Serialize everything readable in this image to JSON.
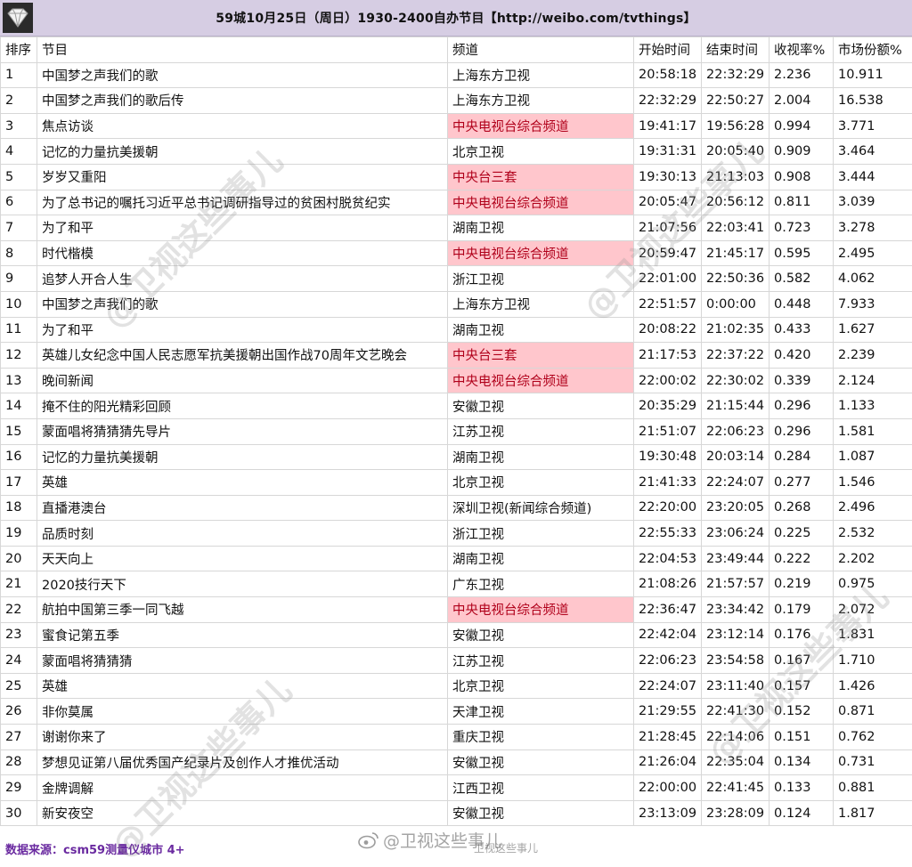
{
  "header": {
    "title": "59城10月25日（周日）1930-2400自办节目【http://weibo.com/tvthings】"
  },
  "columns": [
    "排序",
    "节目",
    "频道",
    "开始时间",
    "结束时间",
    "收视率%",
    "市场份额%"
  ],
  "rows": [
    {
      "rank": "1",
      "program": "中国梦之声我们的歌",
      "channel": "上海东方卫视",
      "start": "20:58:18",
      "end": "22:32:29",
      "rating": "2.236",
      "share": "10.911",
      "hl": false
    },
    {
      "rank": "2",
      "program": "中国梦之声我们的歌后传",
      "channel": "上海东方卫视",
      "start": "22:32:29",
      "end": "22:50:27",
      "rating": "2.004",
      "share": "16.538",
      "hl": false
    },
    {
      "rank": "3",
      "program": "焦点访谈",
      "channel": "中央电视台综合频道",
      "start": "19:41:17",
      "end": "19:56:28",
      "rating": "0.994",
      "share": "3.771",
      "hl": true
    },
    {
      "rank": "4",
      "program": "记忆的力量抗美援朝",
      "channel": "北京卫视",
      "start": "19:31:31",
      "end": "20:05:40",
      "rating": "0.909",
      "share": "3.464",
      "hl": false
    },
    {
      "rank": "5",
      "program": "岁岁又重阳",
      "channel": "中央台三套",
      "start": "19:30:13",
      "end": "21:13:03",
      "rating": "0.908",
      "share": "3.444",
      "hl": true
    },
    {
      "rank": "6",
      "program": "为了总书记的嘱托习近平总书记调研指导过的贫困村脱贫纪实",
      "channel": "中央电视台综合频道",
      "start": "20:05:47",
      "end": "20:56:12",
      "rating": "0.811",
      "share": "3.039",
      "hl": true
    },
    {
      "rank": "7",
      "program": "为了和平",
      "channel": "湖南卫视",
      "start": "21:07:56",
      "end": "22:03:41",
      "rating": "0.723",
      "share": "3.278",
      "hl": false
    },
    {
      "rank": "8",
      "program": "时代楷模",
      "channel": "中央电视台综合频道",
      "start": "20:59:47",
      "end": "21:45:17",
      "rating": "0.595",
      "share": "2.495",
      "hl": true
    },
    {
      "rank": "9",
      "program": "追梦人开合人生",
      "channel": "浙江卫视",
      "start": "22:01:00",
      "end": "22:50:36",
      "rating": "0.582",
      "share": "4.062",
      "hl": false
    },
    {
      "rank": "10",
      "program": "中国梦之声我们的歌",
      "channel": "上海东方卫视",
      "start": "22:51:57",
      "end": "0:00:00",
      "rating": "0.448",
      "share": "7.933",
      "hl": false
    },
    {
      "rank": "11",
      "program": "为了和平",
      "channel": "湖南卫视",
      "start": "20:08:22",
      "end": "21:02:35",
      "rating": "0.433",
      "share": "1.627",
      "hl": false
    },
    {
      "rank": "12",
      "program": "英雄儿女纪念中国人民志愿军抗美援朝出国作战70周年文艺晚会",
      "channel": "中央台三套",
      "start": "21:17:53",
      "end": "22:37:22",
      "rating": "0.420",
      "share": "2.239",
      "hl": true
    },
    {
      "rank": "13",
      "program": "晚间新闻",
      "channel": "中央电视台综合频道",
      "start": "22:00:02",
      "end": "22:30:02",
      "rating": "0.339",
      "share": "2.124",
      "hl": true
    },
    {
      "rank": "14",
      "program": "掩不住的阳光精彩回顾",
      "channel": "安徽卫视",
      "start": "20:35:29",
      "end": "21:15:44",
      "rating": "0.296",
      "share": "1.133",
      "hl": false
    },
    {
      "rank": "15",
      "program": "蒙面唱将猜猜猜先导片",
      "channel": "江苏卫视",
      "start": "21:51:07",
      "end": "22:06:23",
      "rating": "0.296",
      "share": "1.581",
      "hl": false
    },
    {
      "rank": "16",
      "program": "记忆的力量抗美援朝",
      "channel": "湖南卫视",
      "start": "19:30:48",
      "end": "20:03:14",
      "rating": "0.284",
      "share": "1.087",
      "hl": false
    },
    {
      "rank": "17",
      "program": "英雄",
      "channel": "北京卫视",
      "start": "21:41:33",
      "end": "22:24:07",
      "rating": "0.277",
      "share": "1.546",
      "hl": false
    },
    {
      "rank": "18",
      "program": "直播港澳台",
      "channel": "深圳卫视(新闻综合频道)",
      "start": "22:20:00",
      "end": "23:20:05",
      "rating": "0.268",
      "share": "2.496",
      "hl": false
    },
    {
      "rank": "19",
      "program": "品质时刻",
      "channel": "浙江卫视",
      "start": "22:55:33",
      "end": "23:06:24",
      "rating": "0.225",
      "share": "2.532",
      "hl": false
    },
    {
      "rank": "20",
      "program": "天天向上",
      "channel": "湖南卫视",
      "start": "22:04:53",
      "end": "23:49:44",
      "rating": "0.222",
      "share": "2.202",
      "hl": false
    },
    {
      "rank": "21",
      "program": "2020技行天下",
      "channel": "广东卫视",
      "start": "21:08:26",
      "end": "21:57:57",
      "rating": "0.219",
      "share": "0.975",
      "hl": false
    },
    {
      "rank": "22",
      "program": "航拍中国第三季一同飞越",
      "channel": "中央电视台综合频道",
      "start": "22:36:47",
      "end": "23:34:42",
      "rating": "0.179",
      "share": "2.072",
      "hl": true
    },
    {
      "rank": "23",
      "program": "蜜食记第五季",
      "channel": "安徽卫视",
      "start": "22:42:04",
      "end": "23:12:14",
      "rating": "0.176",
      "share": "1.831",
      "hl": false
    },
    {
      "rank": "24",
      "program": "蒙面唱将猜猜猜",
      "channel": "江苏卫视",
      "start": "22:06:23",
      "end": "23:54:58",
      "rating": "0.167",
      "share": "1.710",
      "hl": false
    },
    {
      "rank": "25",
      "program": "英雄",
      "channel": "北京卫视",
      "start": "22:24:07",
      "end": "23:11:40",
      "rating": "0.157",
      "share": "1.426",
      "hl": false
    },
    {
      "rank": "26",
      "program": "非你莫属",
      "channel": "天津卫视",
      "start": "21:29:55",
      "end": "22:41:30",
      "rating": "0.152",
      "share": "0.871",
      "hl": false
    },
    {
      "rank": "27",
      "program": "谢谢你来了",
      "channel": "重庆卫视",
      "start": "21:28:45",
      "end": "22:14:06",
      "rating": "0.151",
      "share": "0.762",
      "hl": false
    },
    {
      "rank": "28",
      "program": "梦想见证第八届优秀国产纪录片及创作人才推优活动",
      "channel": "安徽卫视",
      "start": "21:26:04",
      "end": "22:35:04",
      "rating": "0.134",
      "share": "0.731",
      "hl": false
    },
    {
      "rank": "29",
      "program": "金牌调解",
      "channel": "江西卫视",
      "start": "22:00:00",
      "end": "22:41:45",
      "rating": "0.133",
      "share": "0.881",
      "hl": false
    },
    {
      "rank": "30",
      "program": "新安夜空",
      "channel": "安徽卫视",
      "start": "23:13:09",
      "end": "23:28:09",
      "rating": "0.124",
      "share": "1.817",
      "hl": false
    }
  ],
  "footer": {
    "source": "数据来源：csm59测量仪城市 4+"
  },
  "watermarks": {
    "diagonal": "@卫视这些事儿",
    "weibo": "@卫视这些事儿",
    "weibo_sub": "卫视这些事儿"
  },
  "colors": {
    "title_bg": "#d6cde3",
    "highlight_bg": "#ffc6cc",
    "highlight_text": "#b0001a",
    "source_text": "#6a2aa0"
  },
  "icons": {
    "logo": "diamond-logo-icon",
    "weibo": "weibo-icon"
  }
}
